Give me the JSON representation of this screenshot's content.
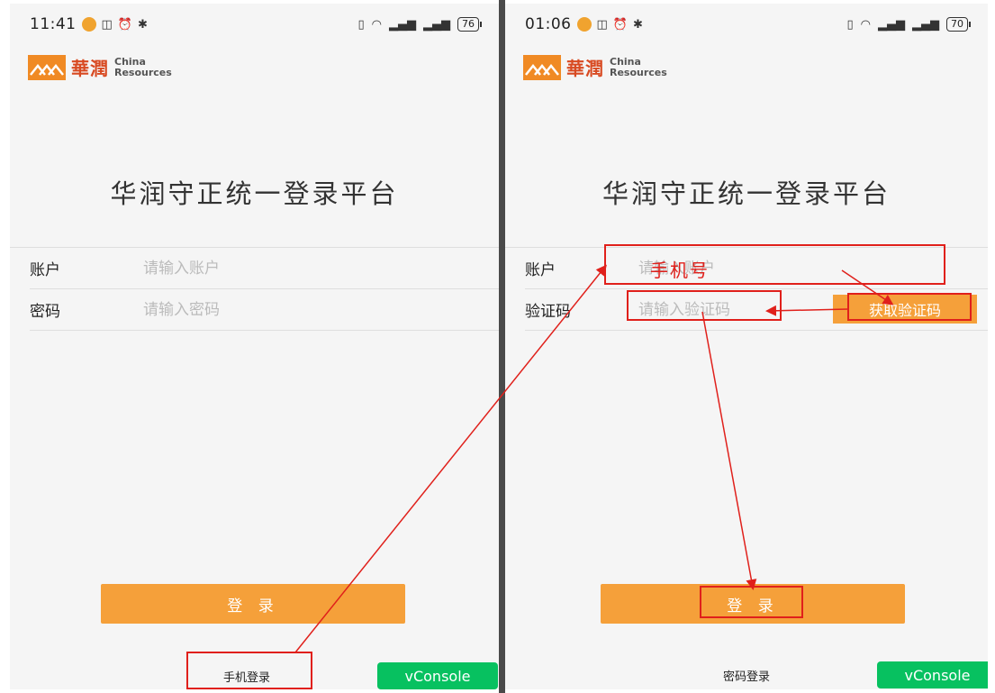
{
  "left_screen": {
    "status": {
      "time": "11:41",
      "battery": "76"
    },
    "logo": {
      "cn": "華潤",
      "en_line1": "China",
      "en_line2": "Resources"
    },
    "title": "华润守正统一登录平台",
    "fields": [
      {
        "label": "账户",
        "placeholder": "请输入账户"
      },
      {
        "label": "密码",
        "placeholder": "请输入密码"
      }
    ],
    "login_label": "登 录",
    "switch_label": "手机登录",
    "vconsole_label": "vConsole"
  },
  "right_screen": {
    "status": {
      "time": "01:06",
      "battery": "70"
    },
    "logo": {
      "cn": "華潤",
      "en_line1": "China",
      "en_line2": "Resources"
    },
    "title": "华润守正统一登录平台",
    "fields": [
      {
        "label": "账户",
        "placeholder": "请输入账户"
      },
      {
        "label": "验证码",
        "placeholder": "请输入验证码"
      }
    ],
    "get_code_label": "获取验证码",
    "login_label": "登 录",
    "switch_label": "密码登录",
    "vconsole_label": "vConsole"
  },
  "annotation": {
    "handwritten_note": "手机号"
  },
  "colors": {
    "accent": "#f5a03a",
    "vconsole": "#07c160",
    "annotation": "#e0201b",
    "logo_red": "#d84a22"
  }
}
